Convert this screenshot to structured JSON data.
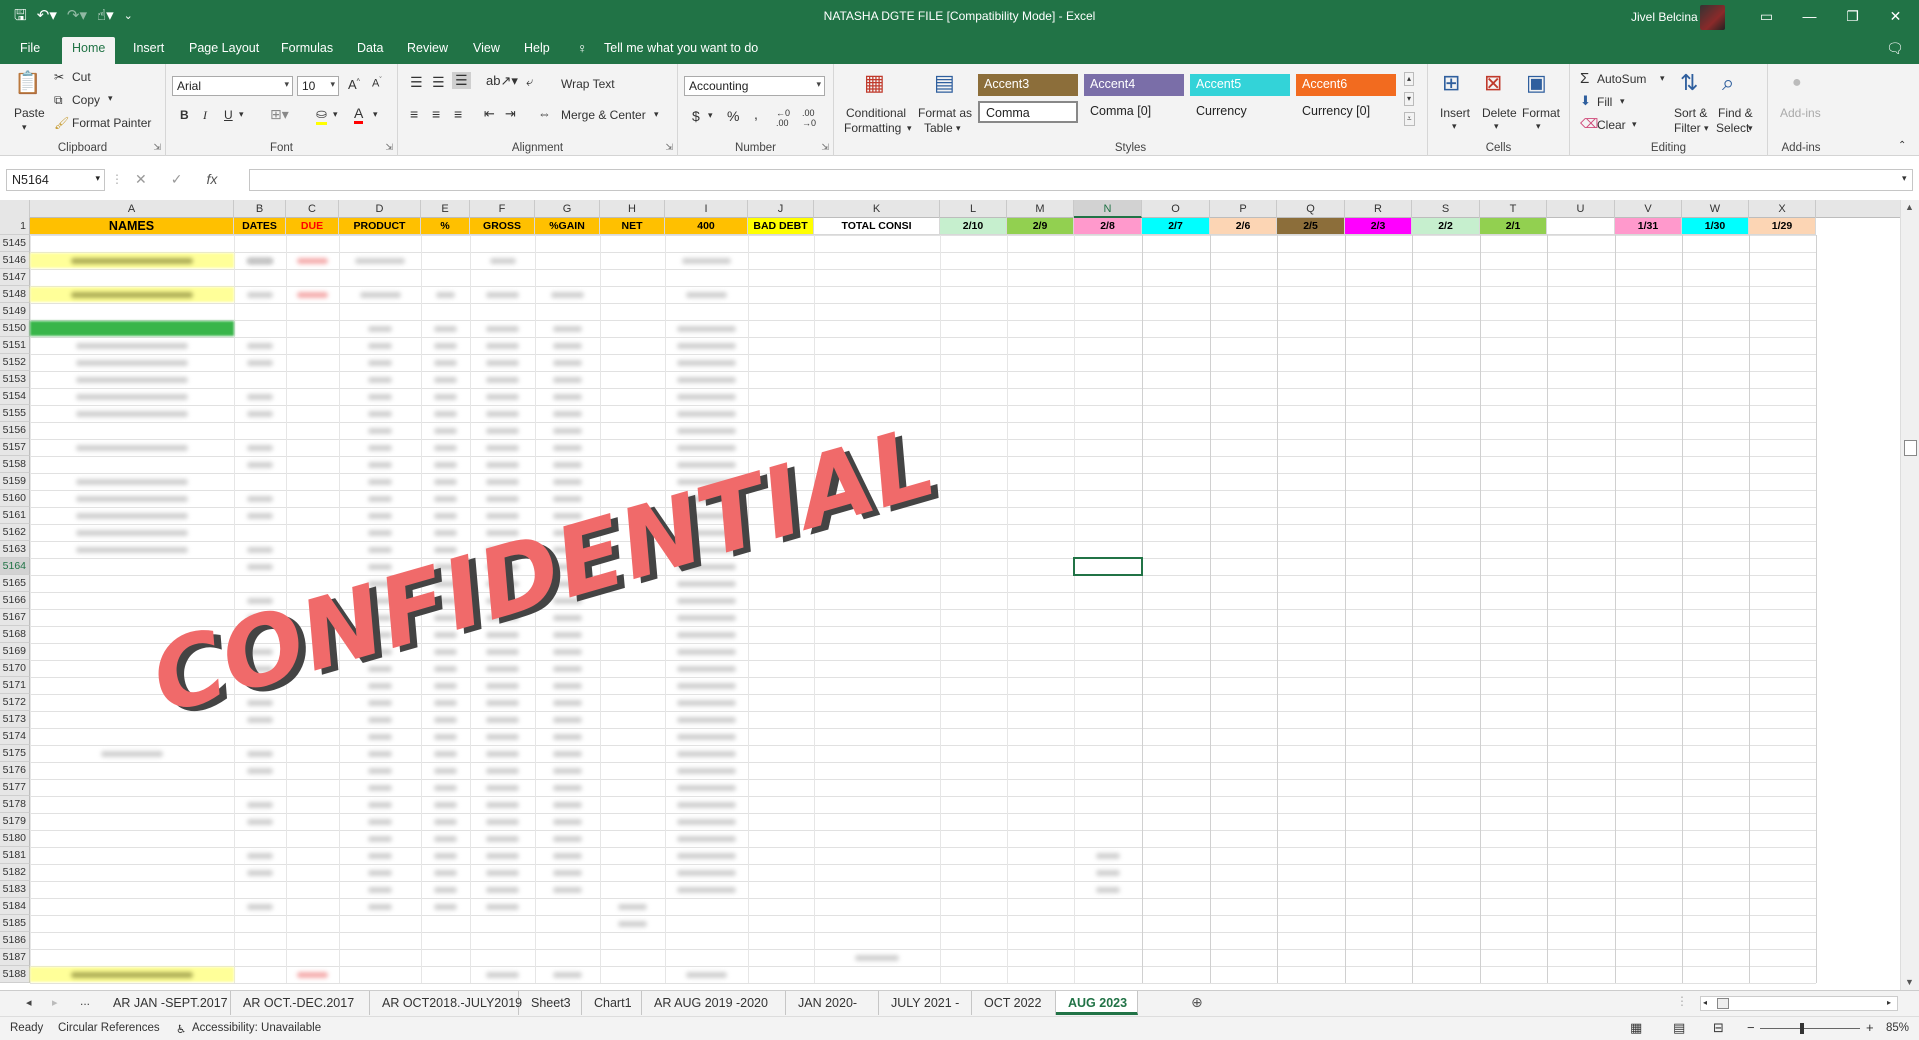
{
  "window": {
    "title": "NATASHA DGTE FILE  [Compatibility Mode]  -  Excel",
    "user": "Jivel Belcina"
  },
  "tabs": [
    "File",
    "Home",
    "Insert",
    "Page Layout",
    "Formulas",
    "Data",
    "Review",
    "View",
    "Help"
  ],
  "active_tab": "Home",
  "tell_me": "Tell me what you want to do",
  "ribbon": {
    "clipboard": {
      "label": "Clipboard",
      "paste": "Paste",
      "cut": "Cut",
      "copy": "Copy",
      "format_painter": "Format Painter"
    },
    "font": {
      "label": "Font",
      "name": "Arial",
      "size": "10"
    },
    "alignment": {
      "label": "Alignment",
      "wrap_text": "Wrap Text",
      "merge_center": "Merge & Center"
    },
    "number": {
      "label": "Number",
      "format": "Accounting"
    },
    "styles": {
      "label": "Styles",
      "conditional": [
        "Conditional",
        "Formatting"
      ],
      "format_as_table": [
        "Format as",
        "Table"
      ],
      "cells": [
        {
          "name": "Accent3",
          "bg": "#8c6e3a",
          "fg": "#ffffff"
        },
        {
          "name": "Accent4",
          "bg": "#7a6ea8",
          "fg": "#ffffff"
        },
        {
          "name": "Accent5",
          "bg": "#33d3d8",
          "fg": "#ffffff"
        },
        {
          "name": "Accent6",
          "bg": "#f26b1f",
          "fg": "#ffffff"
        },
        {
          "name": "Comma",
          "bg": "#ffffff",
          "fg": "#222222"
        },
        {
          "name": "Comma [0]",
          "bg": "#f3f3f3",
          "fg": "#222222"
        },
        {
          "name": "Currency",
          "bg": "#f3f3f3",
          "fg": "#222222"
        },
        {
          "name": "Currency [0]",
          "bg": "#f3f3f3",
          "fg": "#222222"
        }
      ]
    },
    "cells": {
      "label": "Cells",
      "insert": "Insert",
      "delete": "Delete",
      "format": "Format"
    },
    "editing": {
      "label": "Editing",
      "autosum": "AutoSum",
      "fill": "Fill",
      "clear": "Clear",
      "sort": [
        "Sort &",
        "Filter"
      ],
      "find": [
        "Find &",
        "Select"
      ]
    },
    "addins": {
      "label": "Add-ins",
      "button": "Add-ins"
    }
  },
  "formula_bar": {
    "name_box": "N5164",
    "formula": ""
  },
  "columns": [
    {
      "id": "A",
      "header": "NAMES",
      "bg": "#ffc000",
      "fg": "#000000"
    },
    {
      "id": "B",
      "header": "DATES",
      "bg": "#ffc000",
      "fg": "#000000"
    },
    {
      "id": "C",
      "header": "DUE",
      "bg": "#ffc000",
      "fg": "#ff0000"
    },
    {
      "id": "D",
      "header": "PRODUCT",
      "bg": "#ffc000",
      "fg": "#000000"
    },
    {
      "id": "E",
      "header": "%",
      "bg": "#ffc000",
      "fg": "#000000"
    },
    {
      "id": "F",
      "header": "GROSS",
      "bg": "#ffc000",
      "fg": "#000000"
    },
    {
      "id": "G",
      "header": "%GAIN",
      "bg": "#ffc000",
      "fg": "#000000"
    },
    {
      "id": "H",
      "header": "NET",
      "bg": "#ffc000",
      "fg": "#000000"
    },
    {
      "id": "I",
      "header": "400",
      "bg": "#ffc000",
      "fg": "#000000"
    },
    {
      "id": "J",
      "header": "BAD DEBT",
      "bg": "#ffff00",
      "fg": "#000000"
    },
    {
      "id": "K",
      "header": "TOTAL CONSI",
      "bg": "#ffffff",
      "fg": "#000000"
    },
    {
      "id": "L",
      "header": "2/10",
      "bg": "#c6efce",
      "fg": "#000000"
    },
    {
      "id": "M",
      "header": "2/9",
      "bg": "#92d050",
      "fg": "#000000"
    },
    {
      "id": "N",
      "header": "2/8",
      "bg": "#ff99cc",
      "fg": "#000000"
    },
    {
      "id": "O",
      "header": "2/7",
      "bg": "#00ffff",
      "fg": "#000000"
    },
    {
      "id": "P",
      "header": "2/6",
      "bg": "#fcd5b4",
      "fg": "#000000"
    },
    {
      "id": "Q",
      "header": "2/5",
      "bg": "#8c6e3a",
      "fg": "#000000"
    },
    {
      "id": "R",
      "header": "2/3",
      "bg": "#ff00ff",
      "fg": "#000000"
    },
    {
      "id": "S",
      "header": "2/2",
      "bg": "#c6efce",
      "fg": "#000000"
    },
    {
      "id": "T",
      "header": "2/1",
      "bg": "#92d050",
      "fg": "#000000"
    },
    {
      "id": "U",
      "header": "",
      "bg": "#ffffff",
      "fg": "#000000"
    },
    {
      "id": "V",
      "header": "1/31",
      "bg": "#ff99cc",
      "fg": "#000000"
    },
    {
      "id": "W",
      "header": "1/30",
      "bg": "#00ffff",
      "fg": "#000000"
    },
    {
      "id": "X",
      "header": "1/29",
      "bg": "#fcd5b4",
      "fg": "#000000"
    }
  ],
  "first_row": "1",
  "row_numbers": [
    "5145",
    "5146",
    "5147",
    "5148",
    "5149",
    "5150",
    "5151",
    "5152",
    "5153",
    "5154",
    "5155",
    "5156",
    "5157",
    "5158",
    "5159",
    "5160",
    "5161",
    "5162",
    "5163",
    "5164",
    "5165",
    "5166",
    "5167",
    "5168",
    "5169",
    "5170",
    "5171",
    "5172",
    "5173",
    "5174",
    "5175",
    "5176",
    "5177",
    "5178",
    "5179",
    "5180",
    "5181",
    "5182",
    "5183",
    "5184",
    "5185",
    "5186",
    "5187",
    "5188"
  ],
  "selected_row": "5164",
  "selected_col": "N",
  "watermark": "CONFIDENTIAL",
  "sheets": [
    "AR JAN -SEPT.2017",
    "AR OCT.-DEC.2017",
    "AR OCT2018.-JULY2019",
    "Sheet3",
    "Chart1",
    "AR AUG 2019 -2020",
    "JAN 2020-",
    "JULY 2021 -",
    "OCT 2022",
    "AUG 2023"
  ],
  "active_sheet": "AUG 2023",
  "sheet_overflow": "...",
  "status": {
    "ready": "Ready",
    "circular": "Circular References",
    "accessibility": "Accessibility: Unavailable",
    "zoom": "85%"
  }
}
